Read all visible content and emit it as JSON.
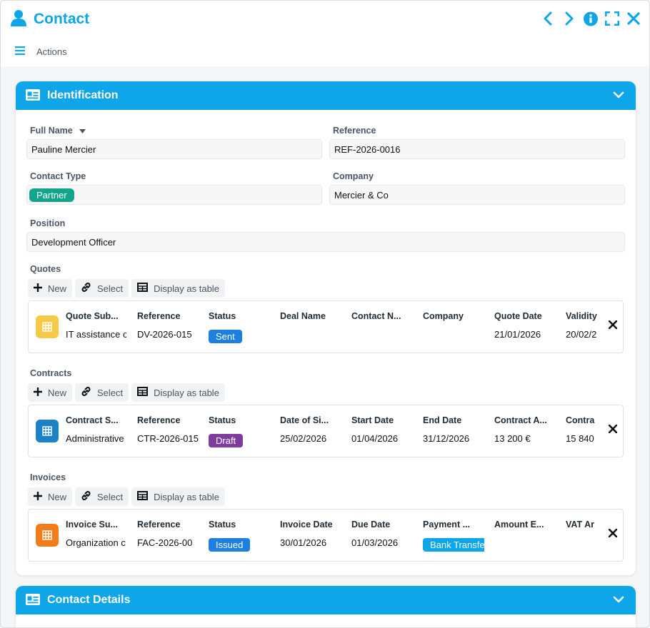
{
  "header": {
    "title": "Contact",
    "actions_label": "Actions"
  },
  "icons": {
    "user": "user-icon",
    "prev": "chevron-left-icon",
    "next": "chevron-right-icon",
    "info": "info-icon",
    "expand": "expand-icon",
    "close": "close-icon",
    "menu": "hamburger-menu-icon",
    "card": "id-card-icon",
    "collapse": "chevron-down-icon"
  },
  "colors": {
    "accent": "#0ea5e9",
    "partner": "#14a38b",
    "sent": "#1d7fe0",
    "draft": "#7e3d9e",
    "issued": "#1d7fe0",
    "bank": "#0ea5e9",
    "quotes_icon": "#f7c948",
    "contracts_icon": "#1d82c5",
    "invoices_icon": "#f07d1a"
  },
  "identification": {
    "title": "Identification",
    "full_name_label": "Full Name",
    "full_name": "Pauline Mercier",
    "reference_label": "Reference",
    "reference": "REF-2026-0016",
    "contact_type_label": "Contact Type",
    "contact_type": "Partner",
    "company_label": "Company",
    "company": "Mercier & Co",
    "position_label": "Position",
    "position": "Development Officer",
    "buttons": {
      "new": "New",
      "select": "Select",
      "table": "Display as table"
    },
    "quotes": {
      "label": "Quotes",
      "columns": [
        "Quote Sub...",
        "Reference",
        "Status",
        "Deal Name",
        "Contact N...",
        "Company",
        "Quote Date",
        "Validity"
      ],
      "row": {
        "subject": "IT assistance c",
        "reference": "DV-2026-015",
        "status": "Sent",
        "deal": "",
        "contact": "",
        "company": "",
        "quote_date": "21/01/2026",
        "validity": "20/02/2"
      }
    },
    "contracts": {
      "label": "Contracts",
      "columns": [
        "Contract S...",
        "Reference",
        "Status",
        "Date of Si...",
        "Start Date",
        "End Date",
        "Contract A...",
        "Contra"
      ],
      "row": {
        "subject": "Administrative",
        "reference": "CTR-2026-015",
        "status": "Draft",
        "signed": "25/02/2026",
        "start": "01/04/2026",
        "end": "31/12/2026",
        "amount": "13 200 €",
        "other": "15 840"
      }
    },
    "invoices": {
      "label": "Invoices",
      "columns": [
        "Invoice Su...",
        "Reference",
        "Status",
        "Invoice Date",
        "Due Date",
        "Payment ...",
        "Amount E...",
        "VAT Ar"
      ],
      "row": {
        "subject": "Organization c",
        "reference": "FAC-2026-00",
        "status": "Issued",
        "invoice_date": "30/01/2026",
        "due_date": "01/03/2026",
        "payment": "Bank Transfe",
        "amount": "",
        "vat": ""
      }
    }
  },
  "contact_details": {
    "title": "Contact Details"
  }
}
